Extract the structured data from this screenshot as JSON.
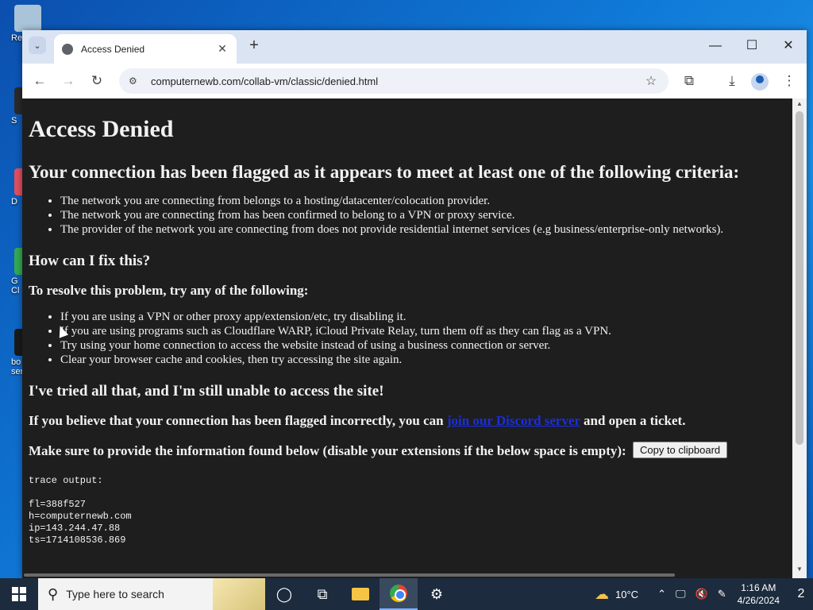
{
  "desktop": {
    "icons": [
      {
        "label": "Rec",
        "color": "#a9c4d9"
      },
      {
        "label": "S",
        "color": "#2a2a2a"
      },
      {
        "label": "D",
        "color": "#e04f5f"
      },
      {
        "label": "G\nCl",
        "color": "#34a853"
      },
      {
        "label": "bo\nser",
        "color": "#1a1a1a"
      }
    ]
  },
  "browser": {
    "tab": {
      "title": "Access Denied",
      "close": "✕"
    },
    "new_tab": "+",
    "window": {
      "minimize": "—",
      "maximize": "☐",
      "close": "✕"
    },
    "toolbar": {
      "back": "←",
      "forward": "→",
      "reload": "↻",
      "bookmark_star": "☆",
      "extensions": "⧉",
      "downloads": "⤓",
      "menu": "⋮"
    },
    "url": "computernewb.com/collab-vm/classic/denied.html"
  },
  "page": {
    "h1": "Access Denied",
    "h2_flagged": "Your connection has been flagged as it appears to meet at least one of the following criteria:",
    "criteria": [
      "The network you are connecting from belongs to a hosting/datacenter/colocation provider.",
      "The network you are connecting from has been confirmed to belong to a VPN or proxy service.",
      "The provider of the network you are connecting from does not provide residential internet services (e.g business/enterprise-only networks)."
    ],
    "h3_fix": "How can I fix this?",
    "h4_resolve": "To resolve this problem, try any of the following:",
    "fixes": [
      "If you are using a VPN or other proxy app/extension/etc, try disabling it.",
      "If you are using programs such as Cloudflare WARP, iCloud Private Relay, turn them off as they can flag as a VPN.",
      "Try using your home connection to access the website instead of using a business connection or server.",
      "Clear your browser cache and cookies, then try accessing the site again."
    ],
    "h3_tried": "I've tried all that, and I'm still unable to access the site!",
    "incorrect_prefix": "If you believe that your connection has been flagged incorrectly, you can ",
    "incorrect_link": "join our Discord server",
    "incorrect_suffix": " and open a ticket.",
    "provide_info": "Make sure to provide the information found below (disable your extensions if the below space is empty):",
    "copy_button": "Copy to clipboard",
    "trace_title": "trace output:",
    "trace_lines": [
      "fl=388f527",
      "h=computernewb.com",
      "ip=143.244.47.88",
      "ts=1714108536.869"
    ]
  },
  "taskbar": {
    "search_placeholder": "Type here to search",
    "weather": "10°C",
    "time": "1:16 AM",
    "date": "4/26/2024",
    "notifications": "2"
  }
}
